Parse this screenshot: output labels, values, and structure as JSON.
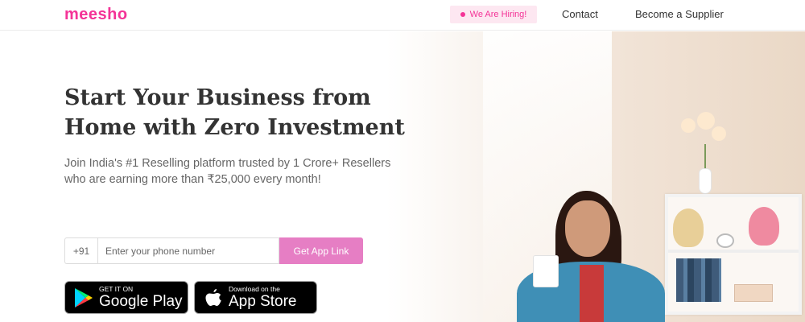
{
  "nav": {
    "logo": "meesho",
    "hiring_label": "We Are Hiring!",
    "contact_label": "Contact",
    "supplier_label": "Become a Supplier"
  },
  "hero": {
    "headline_line1": "Start Your Business from",
    "headline_line2": "Home with Zero Investment",
    "sub_line1": "Join India's #1 Reselling platform trusted by 1 Crore+ Resellers",
    "sub_line2": "who are earning more than ₹25,000 every month!"
  },
  "form": {
    "country_code": "+91",
    "phone_placeholder": "Enter your phone number",
    "phone_value": "",
    "submit_label": "Get App Link"
  },
  "badges": {
    "google_play": {
      "small": "GET IT ON",
      "big": "Google Play",
      "icon": "google-play-icon"
    },
    "app_store": {
      "small": "Download on the",
      "big": "App Store",
      "icon": "apple-icon"
    }
  },
  "colors": {
    "brand": "#f43397",
    "button": "#e67ec4",
    "hiring_bg": "#fde7f1",
    "text_dark": "#333333",
    "text_muted": "#666666"
  }
}
